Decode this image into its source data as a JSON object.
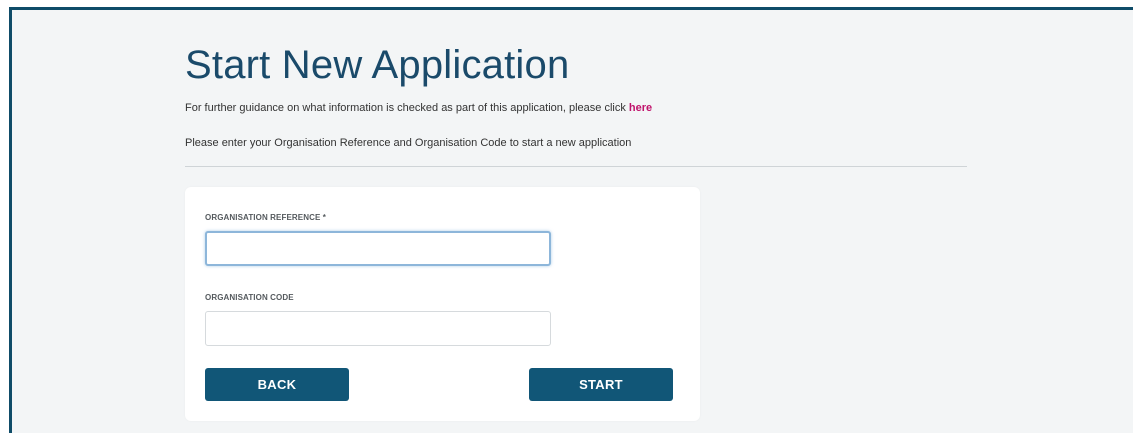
{
  "page": {
    "title": "Start New Application",
    "guidance_text": "For further guidance on what information is checked as part of this application, please click ",
    "guidance_link": "here",
    "instruction": "Please enter your Organisation Reference and Organisation Code to start a new application"
  },
  "form": {
    "organisation_reference": {
      "label": "ORGANISATION REFERENCE *",
      "value": "",
      "placeholder": ""
    },
    "organisation_code": {
      "label": "ORGANISATION CODE",
      "value": "",
      "placeholder": ""
    },
    "back_label": "BACK",
    "start_label": "START"
  },
  "colors": {
    "primary": "#115677",
    "title": "#1a4a6a",
    "link": "#c0126b",
    "frame_border": "#0f4c68",
    "background": "#f3f5f6"
  }
}
